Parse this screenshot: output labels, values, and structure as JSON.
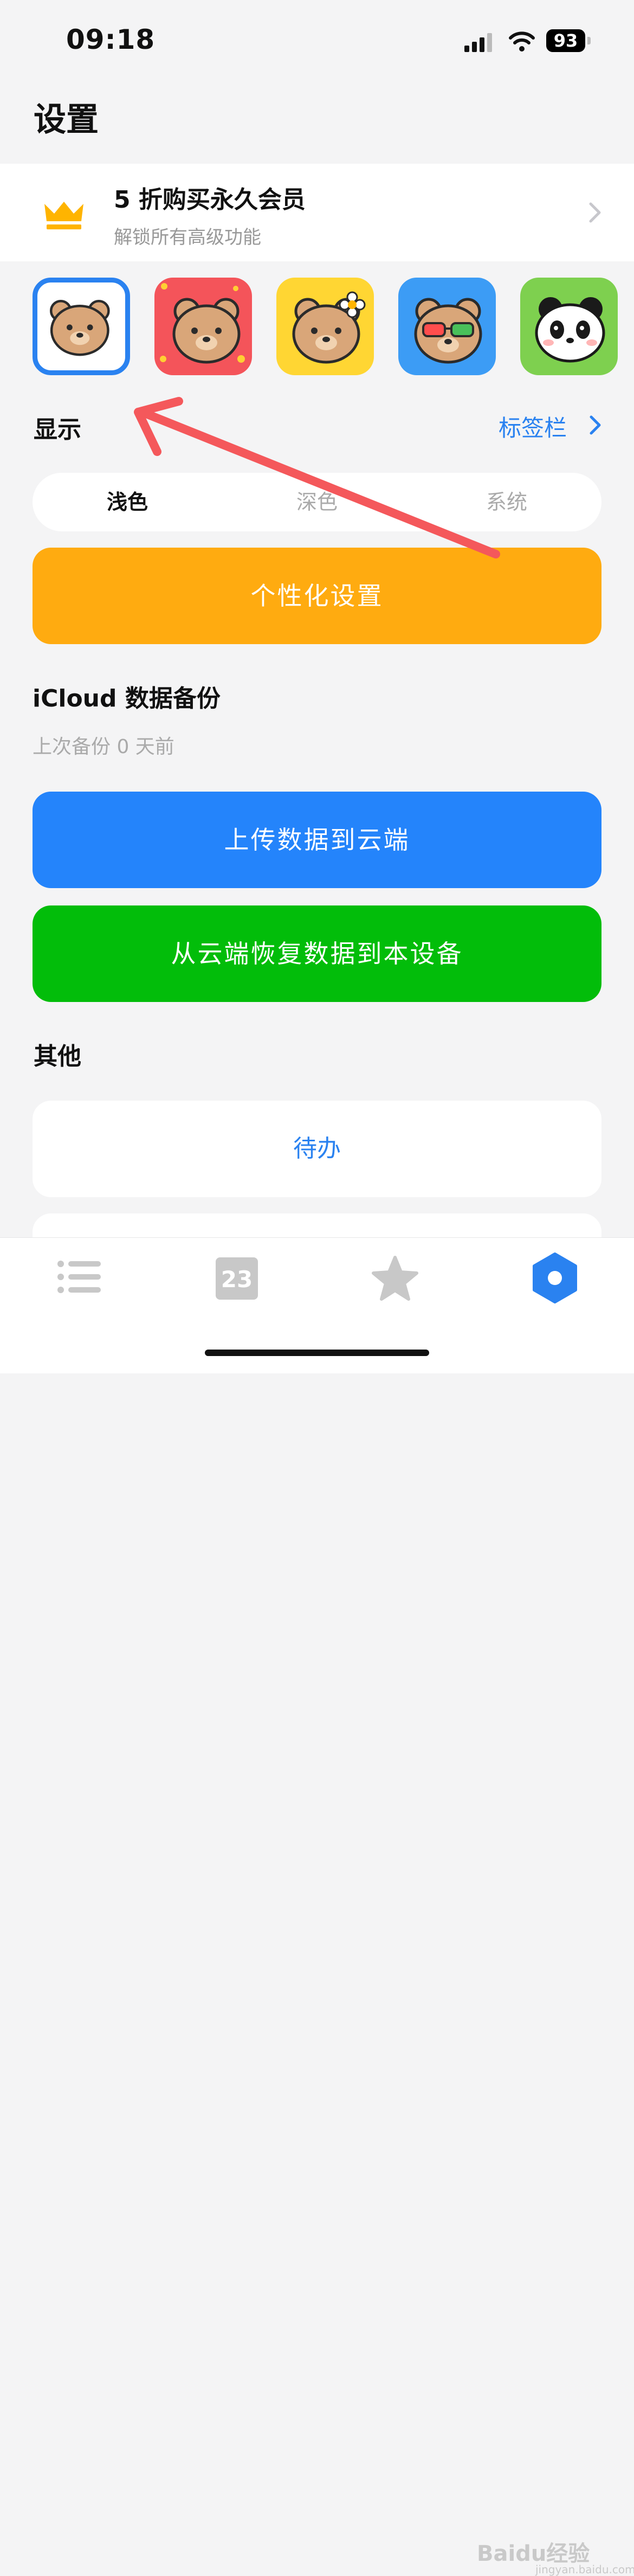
{
  "status_bar": {
    "time": "09:18",
    "battery": "93"
  },
  "page_title": "设置",
  "premium": {
    "title": "5 折购买永久会员",
    "subtitle": "解锁所有高级功能"
  },
  "app_icons": [
    {
      "name": "bear-white",
      "selected": true
    },
    {
      "name": "bear-red-flowers",
      "selected": false
    },
    {
      "name": "bear-yellow-flower",
      "selected": false
    },
    {
      "name": "bear-blue-sunglasses",
      "selected": false
    },
    {
      "name": "panda-green",
      "selected": false
    }
  ],
  "display": {
    "label": "显示",
    "tab_bar_link": "标签栏",
    "appearance_options": [
      "浅色",
      "深色",
      "系统"
    ],
    "selected_appearance": "浅色"
  },
  "personalize_button": "个性化设置",
  "icloud": {
    "label": "iCloud 数据备份",
    "last_backup": "上次备份 0 天前",
    "upload_button": "上传数据到云端",
    "restore_button": "从云端恢复数据到本设备"
  },
  "other": {
    "label": "其他",
    "todo_item": "待办"
  },
  "tab_bar": {
    "calendar_day": "23",
    "items": [
      "list-icon",
      "calendar-icon",
      "star-icon",
      "settings-hexagon-icon"
    ]
  },
  "watermark": {
    "brand": "Baidu经验",
    "url": "jingyan.baidu.com"
  },
  "colors": {
    "accent_blue": "#2a82f0",
    "orange": "#ffab10",
    "upload_blue": "#2484fb",
    "green": "#02bd0a",
    "annotation_red": "#f4585b"
  }
}
